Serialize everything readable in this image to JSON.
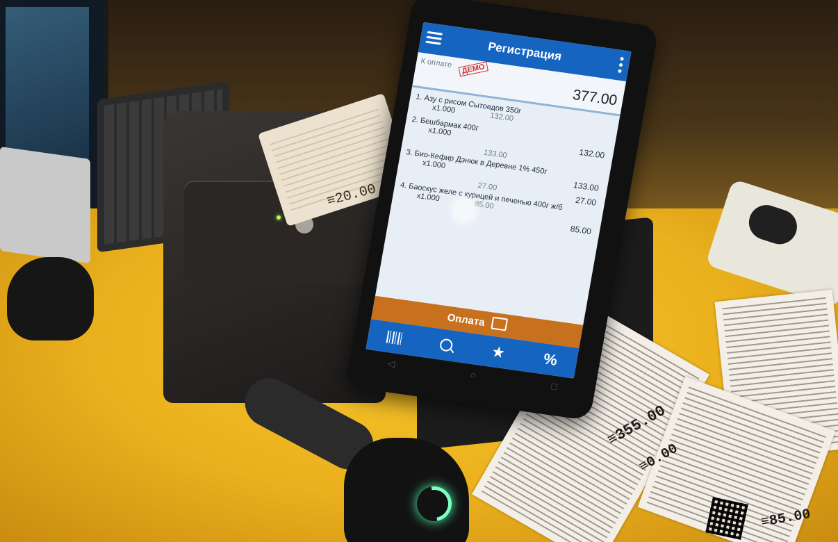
{
  "app": {
    "title": "Регистрация"
  },
  "receipt_header": {
    "to_pay_label": "К оплате",
    "demo_label": "ДЕМО",
    "total": "377.00"
  },
  "items": [
    {
      "name": "1. Азу с рисом Сытоедов 350г",
      "qty": "x1.000",
      "price": "",
      "sum": ""
    },
    {
      "name": "2. Бешбармак 400г",
      "qty": "x1.000",
      "price": "132.00",
      "sum": "132.00"
    },
    {
      "name": "3. Био-Кефир Дэнюк в Деревне 1% 450г",
      "qty": "x1.000",
      "price": "133.00",
      "sum": "133.00"
    },
    {
      "name": "4. Баоскус желе с курицей и печенью 400г ж/б",
      "qty": "x1.000",
      "price": "27.00",
      "sum": "27.00"
    },
    {
      "name": "",
      "qty": "x1.000",
      "price": "85.00",
      "sum": "85.00"
    }
  ],
  "pay_button": {
    "label": "Оплата"
  },
  "bottom_nav": {
    "barcode_icon": "barcode-icon",
    "search_icon": "search-icon",
    "star_icon": "star-icon",
    "percent_label": "%"
  },
  "printed_values": {
    "roll_total": "≡20.00",
    "receipt1_total": "≡355.00",
    "receipt1_zero": "≡0.00",
    "receipt3_total": "≡85.00"
  },
  "colors": {
    "appbar": "#1565c0",
    "pay_bar": "#c7701e",
    "demo_stamp": "#d32f2f"
  }
}
